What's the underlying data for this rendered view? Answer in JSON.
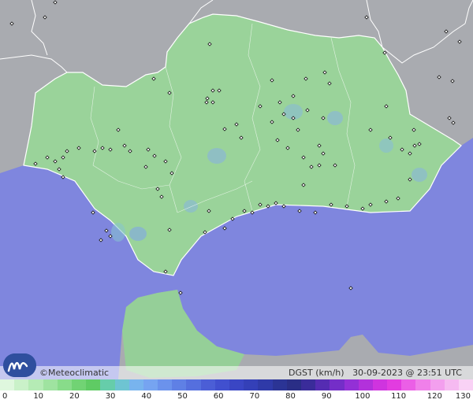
{
  "map": {
    "colors": {
      "sea": "#7f86de",
      "land_outside": "#a9abb0",
      "andalusia": "#9ad39a",
      "borders": "#ffffff",
      "station": "#111111"
    }
  },
  "credit": {
    "symbol": "©",
    "brand": "Meteoclimatic"
  },
  "caption": {
    "variable": "DGST (km/h)",
    "datetime": "30-09-2023 @ 23:51 UTC"
  },
  "legend": {
    "unit": "km/h",
    "ticks": [
      "0",
      "10",
      "20",
      "30",
      "40",
      "50",
      "60",
      "70",
      "80",
      "90",
      "100",
      "110",
      "120",
      "130"
    ],
    "colors": [
      "#dff7de",
      "#caf1c9",
      "#b5ebb5",
      "#9fe3a0",
      "#88dc8a",
      "#71d374",
      "#5fcb64",
      "#66cdaa",
      "#6ec4d2",
      "#78b4ee",
      "#76a4f1",
      "#6b92ec",
      "#5f80e5",
      "#556fde",
      "#4b5ed6",
      "#4150cf",
      "#3a46c4",
      "#3440b8",
      "#2f3aa8",
      "#2b3495",
      "#2a2e86",
      "#3a2c9a",
      "#552cb2",
      "#742ec8",
      "#9330d6",
      "#b231db",
      "#cf34df",
      "#e23ce0",
      "#eb5fe6",
      "#f080ea",
      "#f39fee",
      "#f6baf1",
      "#f9d2f5"
    ]
  }
}
